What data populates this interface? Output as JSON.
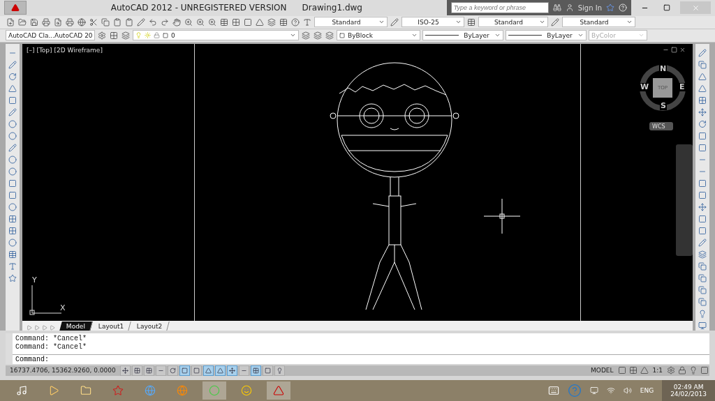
{
  "window": {
    "title": "AutoCAD 2012 - UNREGISTERED VERSION",
    "document": "Drawing1.dwg"
  },
  "infocenter": {
    "placeholder": "Type a keyword or phrase",
    "sign_in": "Sign In"
  },
  "style_dropdowns": [
    {
      "value": "Standard"
    },
    {
      "value": "ISO-25"
    },
    {
      "value": "Standard"
    },
    {
      "value": "Standard"
    }
  ],
  "workspace": {
    "value": "AutoCAD Cla...AutoCAD 20"
  },
  "layer": {
    "value": "0"
  },
  "property_dropdowns": [
    {
      "kind": "color",
      "value": "ByBlock",
      "disabled": false
    },
    {
      "kind": "linetype",
      "value": "ByLayer",
      "disabled": false
    },
    {
      "kind": "lineweight",
      "value": "ByLayer",
      "disabled": false
    },
    {
      "kind": "plot",
      "value": "ByColor",
      "disabled": true
    }
  ],
  "viewport": {
    "label": "[–] [Top] [2D Wireframe]"
  },
  "viewcube": {
    "north": "N",
    "south": "S",
    "east": "E",
    "west": "W",
    "face": "TOP",
    "ucs": "WCS"
  },
  "ucs_icon": {
    "x": "X",
    "y": "Y"
  },
  "layout_tabs": [
    {
      "label": "Model",
      "selected": true
    },
    {
      "label": "Layout1",
      "selected": false
    },
    {
      "label": "Layout2",
      "selected": false
    }
  ],
  "command_history": [
    "Command: *Cancel*",
    "Command: *Cancel*"
  ],
  "command_prompt": "Command:",
  "status_bar": {
    "coordinates": "16737.4706, 15362.9260, 0.0000",
    "toggles": [
      {
        "on": false
      },
      {
        "on": false
      },
      {
        "on": false
      },
      {
        "on": false
      },
      {
        "on": false
      },
      {
        "on": true
      },
      {
        "on": false
      },
      {
        "on": true
      },
      {
        "on": true
      },
      {
        "on": true
      },
      {
        "on": false
      },
      {
        "on": true
      },
      {
        "on": false
      },
      {
        "on": false
      }
    ],
    "space": "MODEL",
    "scale": "1:1"
  },
  "taskbar": {
    "language": "ENG",
    "time": "02:49 AM",
    "date": "24/02/2013"
  }
}
